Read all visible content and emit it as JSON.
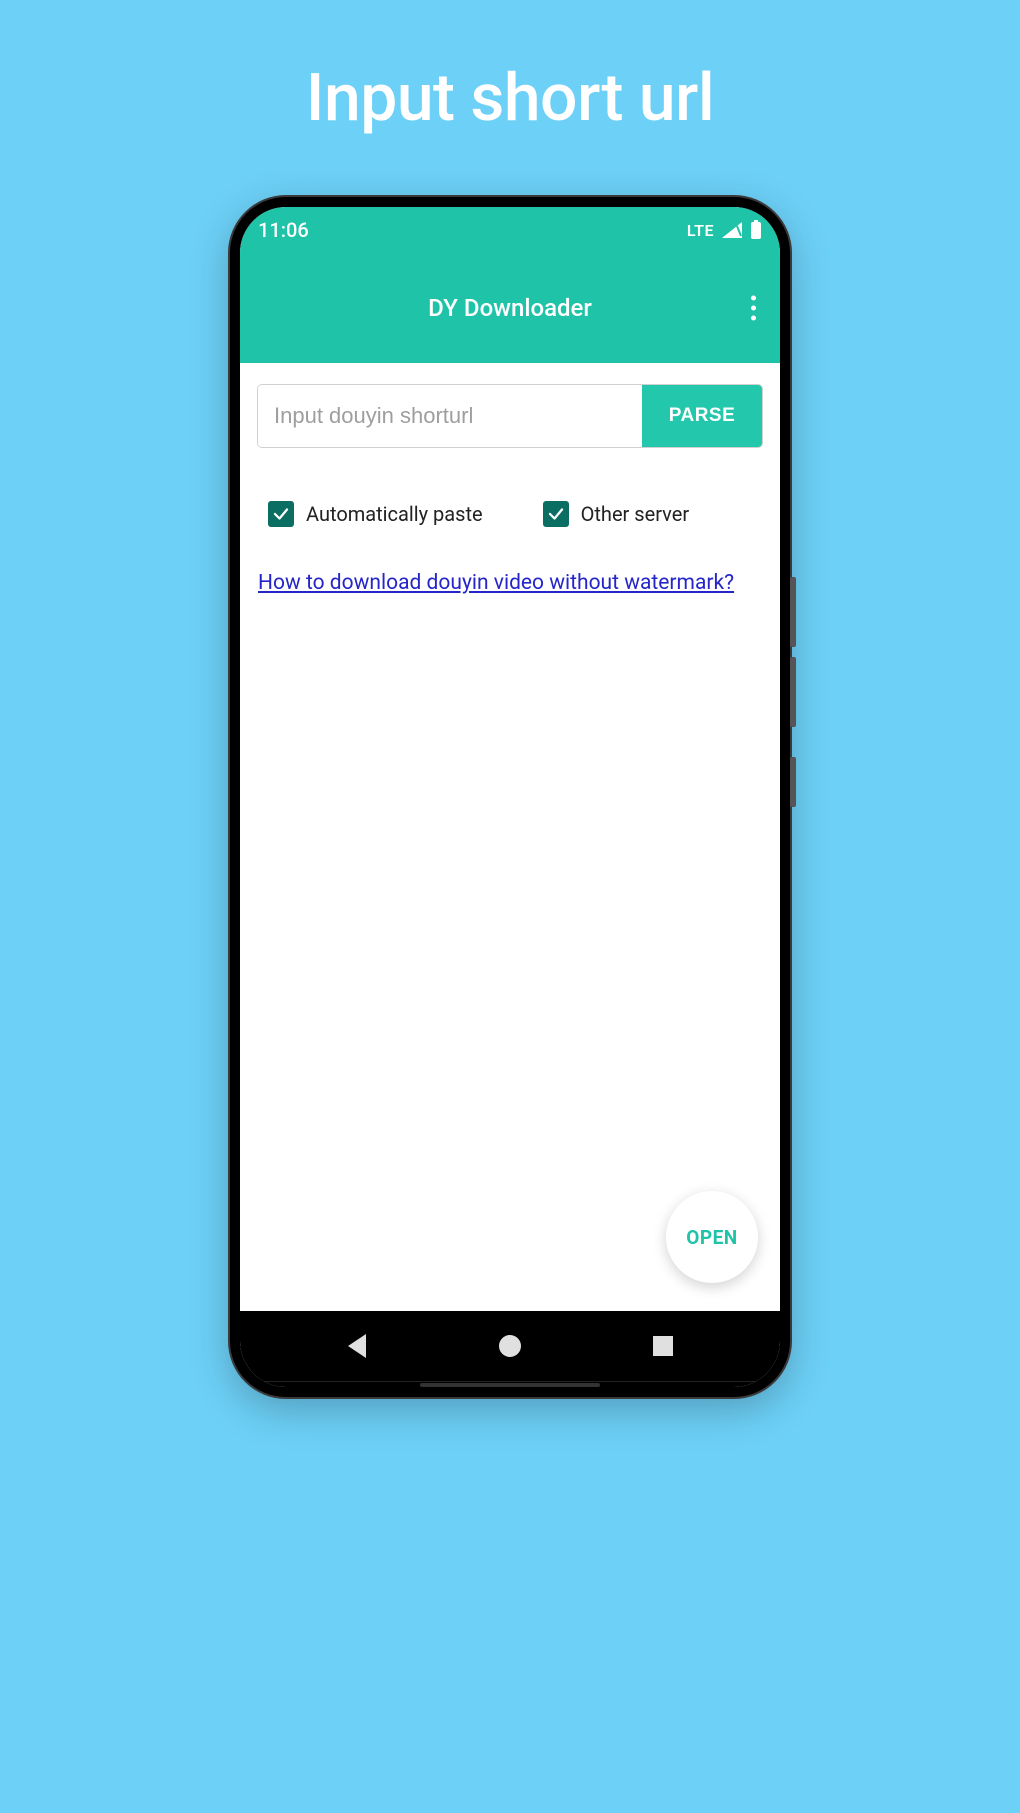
{
  "hero": {
    "title": "Input short url"
  },
  "status": {
    "time": "11:06",
    "network": "LTE"
  },
  "app": {
    "title": "DY Downloader"
  },
  "form": {
    "url_placeholder": "Input douyin shorturl",
    "parse_label": "PARSE"
  },
  "options": {
    "auto_paste_label": "Automatically paste",
    "other_server_label": "Other server"
  },
  "help": {
    "link_text": "How to download douyin video without watermark?"
  },
  "fab": {
    "label": "OPEN"
  }
}
